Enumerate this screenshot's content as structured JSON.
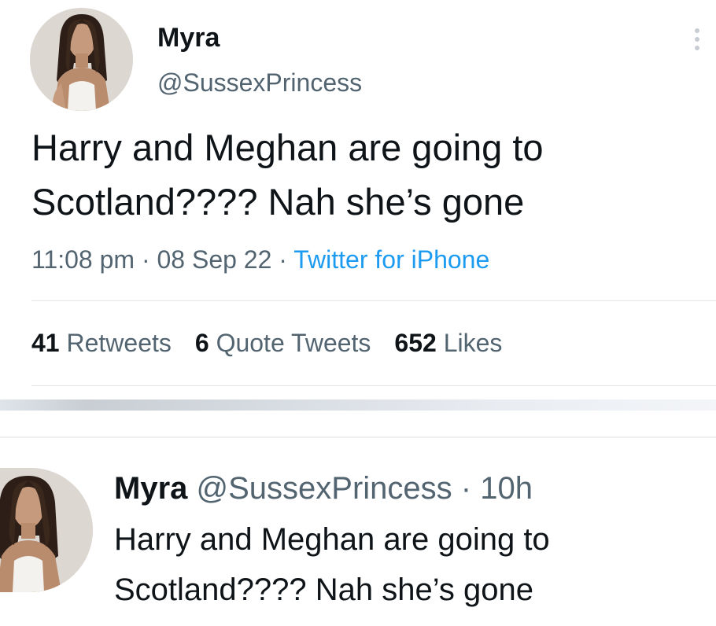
{
  "detail_tweet": {
    "display_name": "Myra",
    "handle": "@SussexPrincess",
    "text_line1": "Harry and Meghan are going to",
    "text_line2": "Scotland???? Nah she’s gone",
    "time": "11:08 pm",
    "date": "08 Sep 22",
    "separator": "·",
    "source": "Twitter for iPhone",
    "retweets_count": "41",
    "retweets_label": "Retweets",
    "quotes_count": "6",
    "quotes_label": "Quote Tweets",
    "likes_count": "652",
    "likes_label": "Likes",
    "more_icon": "more-vertical-icon"
  },
  "timeline_tweet": {
    "display_name": "Myra",
    "handle": "@SussexPrincess",
    "separator": "·",
    "age": "10h",
    "text_line1": "Harry and Meghan are going to",
    "text_line2": "Scotland???? Nah she’s gone"
  },
  "colors": {
    "text_primary": "#0f1419",
    "text_secondary": "#536471",
    "link": "#1d9bf0",
    "divider": "#e3e7ea"
  }
}
